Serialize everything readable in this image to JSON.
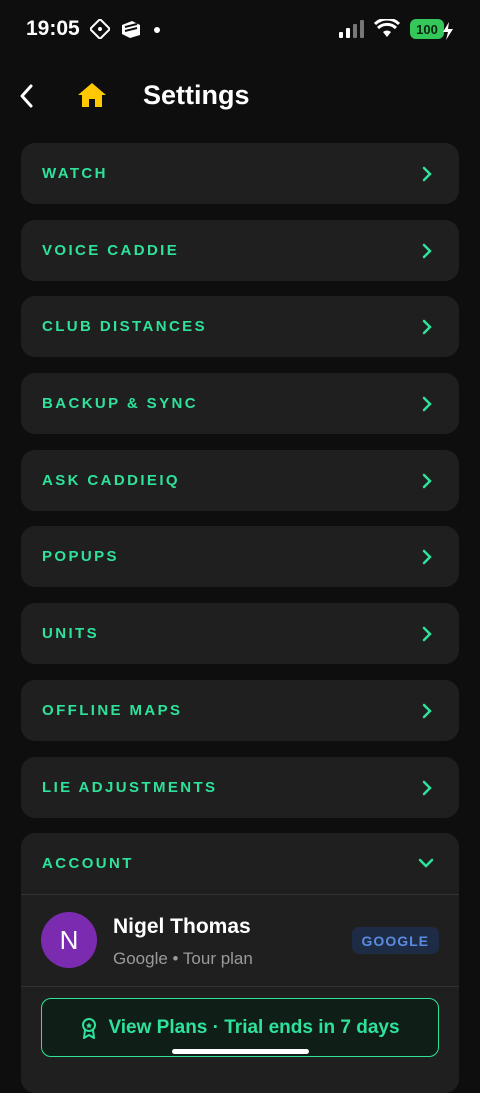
{
  "status_bar": {
    "time": "19:05",
    "battery": "100"
  },
  "header": {
    "title": "Settings"
  },
  "menu": [
    {
      "label": "WATCH"
    },
    {
      "label": "VOICE CADDIE"
    },
    {
      "label": "CLUB DISTANCES"
    },
    {
      "label": "BACKUP & SYNC"
    },
    {
      "label": "ASK CADDIEIQ"
    },
    {
      "label": "POPUPS"
    },
    {
      "label": "UNITS"
    },
    {
      "label": "OFFLINE MAPS"
    },
    {
      "label": "LIE ADJUSTMENTS"
    }
  ],
  "account": {
    "label": "ACCOUNT",
    "avatar_initial": "N",
    "name": "Nigel Thomas",
    "subtitle": "Google • Tour plan",
    "provider_badge": "GOOGLE",
    "plans_button": "View Plans · Trial ends in 7 days"
  },
  "colors": {
    "accent": "#2ee29a",
    "background": "#0e0e0e",
    "card": "#1f1f1f",
    "avatar": "#7b2bb0",
    "home_icon": "#ffc800"
  },
  "icons": [
    "back-arrow-icon",
    "home-icon",
    "chevron-right-icon",
    "chevron-down-icon",
    "award-icon"
  ]
}
